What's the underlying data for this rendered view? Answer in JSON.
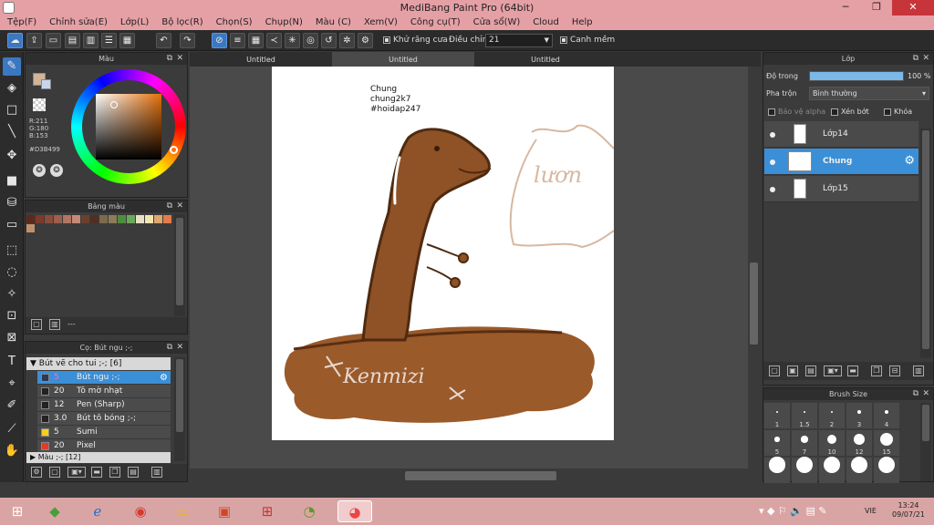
{
  "window": {
    "title": "MediBang Paint Pro (64bit)",
    "minimize": "─",
    "restore": "❐",
    "close": "✕"
  },
  "menu": [
    "Tệp(F)",
    "Chỉnh sửa(E)",
    "Lớp(L)",
    "Bộ lọc(R)",
    "Chọn(S)",
    "Chụp(N)",
    "Màu (C)",
    "Xem(V)",
    "Công cụ(T)",
    "Cửa sổ(W)",
    "Cloud",
    "Help"
  ],
  "toolbar": {
    "antialias_label": "Khử răng cưa",
    "adjust_label": "Điều chỉnh",
    "adjust_value": "21",
    "smooth_label": "Canh mềm"
  },
  "color_panel": {
    "title": "Màu",
    "r": "R:211",
    "g": "G:180",
    "b": "B:153",
    "hex": "#D3B499",
    "fg_color": "#D3B499",
    "bg_color": "#c6d6ee"
  },
  "palette_panel": {
    "title": "Bảng màu",
    "footer": "---",
    "colors": [
      "#5b2a1d",
      "#7a3b2a",
      "#8a4c3b",
      "#9b5f4c",
      "#b07563",
      "#c48a77",
      "#6b3f30",
      "#503020",
      "#7b6a4d",
      "#8d7b5a",
      "#4d8d3e",
      "#6aa85a",
      "#e8e0c8",
      "#f2e6b0",
      "#e0a670",
      "#e47b4a",
      "#c0906e"
    ]
  },
  "brush_panel": {
    "title": "Cọ: Bút ngu ;-;",
    "group": "Bút vẽ cho tui ;-; [6]",
    "group2": "Màu ;-; [12]",
    "items": [
      {
        "size": "5",
        "name": "Bút ngu ;-;",
        "color": "#2a3a55"
      },
      {
        "size": "20",
        "name": "Tô mờ nhạt",
        "color": "#222222"
      },
      {
        "size": "12",
        "name": "Pen (Sharp)",
        "color": "#222222"
      },
      {
        "size": "3.0",
        "name": "Bút tô bóng ;-;",
        "color": "#222222"
      },
      {
        "size": "5",
        "name": "Sumi",
        "color": "#f5d11a"
      },
      {
        "size": "20",
        "name": "Pixel",
        "color": "#e33a2a"
      }
    ]
  },
  "tabs": [
    "Untitled",
    "Untitled",
    "Untitled"
  ],
  "canvas": {
    "note_line1": "Chung",
    "note_line2": "chung2k7",
    "note_line3": "#hoidap247",
    "speech": "lươn",
    "signature": "Kenmizi"
  },
  "layer_panel": {
    "title": "Lớp",
    "opacity_label": "Độ trong",
    "opacity_value": "100 %",
    "opacity": 1.0,
    "blend_label": "Pha trộn",
    "blend_value": "Bình thường",
    "protect_alpha": "Bảo vệ alpha",
    "clipping": "Xén bớt",
    "lock": "Khóa",
    "layers": [
      {
        "name": "Lớp14",
        "selected": false
      },
      {
        "name": "Chung",
        "selected": true
      },
      {
        "name": "Lớp15",
        "selected": false
      }
    ]
  },
  "brush_size_panel": {
    "title": "Brush Size",
    "sizes": [
      "1",
      "1.5",
      "2",
      "3",
      "4",
      "5",
      "7",
      "10",
      "12",
      "15",
      "",
      "",
      "",
      "",
      ""
    ]
  },
  "taskbar": {
    "lang": "VIE",
    "time": "13:24",
    "date": "09/07/21"
  }
}
